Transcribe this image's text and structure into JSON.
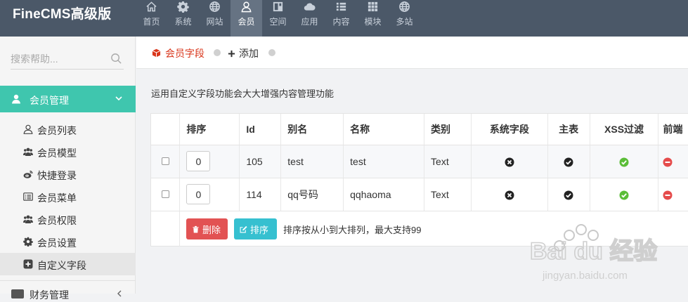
{
  "brand": "FineCMS高级版",
  "nav": [
    {
      "label": "首页",
      "icon": "home-icon"
    },
    {
      "label": "系统",
      "icon": "gear-icon"
    },
    {
      "label": "网站",
      "icon": "globe-icon"
    },
    {
      "label": "会员",
      "icon": "user-icon",
      "active": true
    },
    {
      "label": "空间",
      "icon": "window-icon"
    },
    {
      "label": "应用",
      "icon": "cloud-icon"
    },
    {
      "label": "内容",
      "icon": "list-icon"
    },
    {
      "label": "模块",
      "icon": "grid-icon"
    },
    {
      "label": "多站",
      "icon": "globe-icon"
    }
  ],
  "sidebar": {
    "search_placeholder": "搜索帮助...",
    "group_active": "会员管理",
    "items": [
      {
        "label": "会员列表",
        "icon": "user-outline-icon"
      },
      {
        "label": "会员模型",
        "icon": "users-icon"
      },
      {
        "label": "快捷登录",
        "icon": "weibo-icon"
      },
      {
        "label": "会员菜单",
        "icon": "list-box-icon"
      },
      {
        "label": "会员权限",
        "icon": "users-icon"
      },
      {
        "label": "会员设置",
        "icon": "gear-icon"
      },
      {
        "label": "自定义字段",
        "icon": "plus-square-icon",
        "active": true
      }
    ],
    "group_next": "财务管理"
  },
  "breadcrumb": {
    "current": "会员字段",
    "add": "添加"
  },
  "description": "运用自定义字段功能会大大增强内容管理功能",
  "table": {
    "headers": [
      "排序",
      "Id",
      "别名",
      "名称",
      "类别",
      "系统字段",
      "主表",
      "XSS过滤",
      "前端"
    ],
    "rows": [
      {
        "order": "0",
        "id": "105",
        "alias": "test",
        "name": "test",
        "type": "Text"
      },
      {
        "order": "0",
        "id": "114",
        "alias": "qq号码",
        "name": "qqhaoma",
        "type": "Text"
      }
    ]
  },
  "actions": {
    "delete_label": "删除",
    "sort_label": "排序",
    "hint": "排序按从小到大排列，最大支持99"
  },
  "colors": {
    "topbar": "#4b5868",
    "accent": "#3fc6ae",
    "danger": "#e25253",
    "info": "#36c0d0",
    "crumb_red": "#d9361b"
  },
  "watermark": {
    "line1": "Bai du 经验",
    "line2": "jingyan.baidu.com"
  }
}
